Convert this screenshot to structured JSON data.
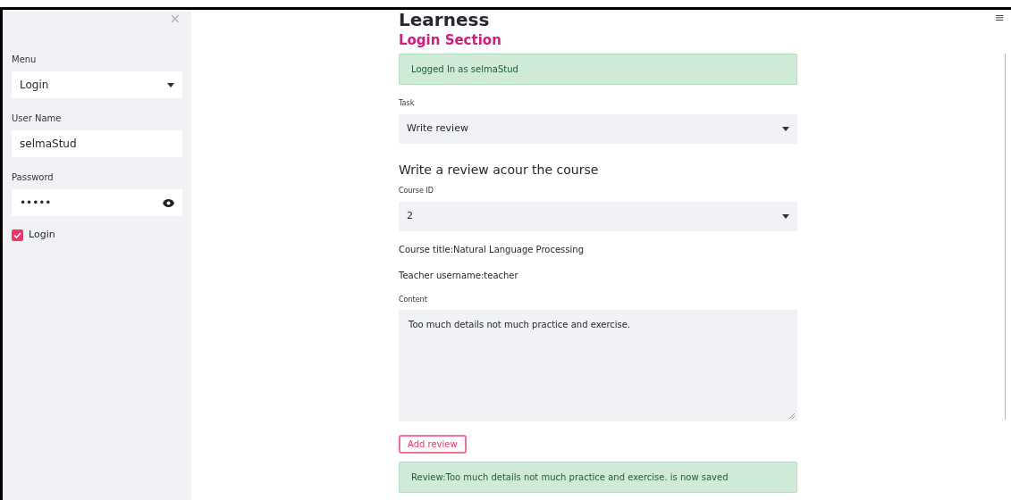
{
  "sidebar": {
    "close": "×",
    "fields": [
      {
        "kind": "select",
        "label": "Menu",
        "value": "Login"
      },
      {
        "kind": "text",
        "label": "User Name",
        "value": "selmaStud"
      },
      {
        "kind": "password",
        "label": "Password",
        "value": "•••••"
      }
    ],
    "checkbox": {
      "label": "Login",
      "checked": true
    }
  },
  "main": {
    "title": "Learness",
    "subtitle": "Login Section",
    "login_alert": "Logged In as selmaStud",
    "task": {
      "label": "Task",
      "value": "Write review"
    },
    "heading": "Write a review acour the course",
    "course_id": {
      "label": "Course ID",
      "value": "2"
    },
    "course_title": "Course title:Natural Language Processing",
    "teacher": "Teacher username:teacher",
    "content": {
      "label": "Content",
      "value": "Too much details not much practice and exercise."
    },
    "button": "Add review",
    "saved_alert": "Review:Too much details not much practice and exercise. is now saved"
  },
  "menu_icon": "≡"
}
